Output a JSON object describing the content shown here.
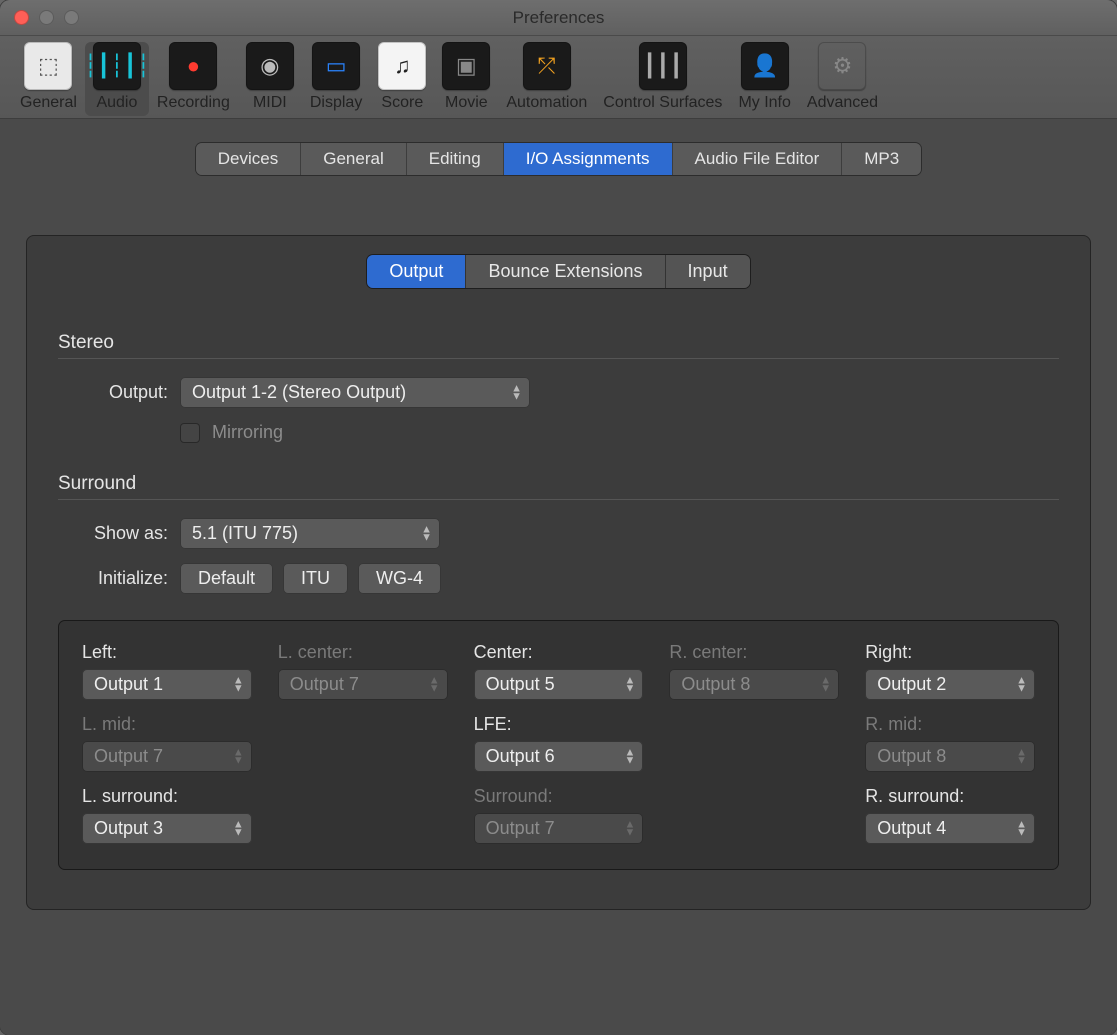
{
  "window": {
    "title": "Preferences"
  },
  "traffic": {
    "close": "#ff5f57",
    "min": "#7a7a7a",
    "max": "#7a7a7a"
  },
  "toolbar": [
    {
      "id": "general",
      "label": "General",
      "icon_bg": "#e9e9e9",
      "glyph": "⬚",
      "glyph_color": "#555"
    },
    {
      "id": "audio",
      "label": "Audio",
      "icon_bg": "#1a1a1a",
      "glyph": "┆┃┆┃┆",
      "glyph_color": "#18c4d8",
      "selected": true
    },
    {
      "id": "recording",
      "label": "Recording",
      "icon_bg": "#1a1a1a",
      "glyph": "●",
      "glyph_color": "#ff3b30"
    },
    {
      "id": "midi",
      "label": "MIDI",
      "icon_bg": "#1a1a1a",
      "glyph": "◉",
      "glyph_color": "#bbb"
    },
    {
      "id": "display",
      "label": "Display",
      "icon_bg": "#1a1a1a",
      "glyph": "▭",
      "glyph_color": "#2a84ff"
    },
    {
      "id": "score",
      "label": "Score",
      "icon_bg": "#f4f4f4",
      "glyph": "♫",
      "glyph_color": "#222"
    },
    {
      "id": "movie",
      "label": "Movie",
      "icon_bg": "#1a1a1a",
      "glyph": "▣",
      "glyph_color": "#888"
    },
    {
      "id": "automation",
      "label": "Automation",
      "icon_bg": "#1a1a1a",
      "glyph": "⤱",
      "glyph_color": "#f0a020"
    },
    {
      "id": "control",
      "label": "Control Surfaces",
      "icon_bg": "#1a1a1a",
      "glyph": "┃┃┃",
      "glyph_color": "#aaa"
    },
    {
      "id": "myinfo",
      "label": "My Info",
      "icon_bg": "#1a1a1a",
      "glyph": "👤",
      "glyph_color": "#777"
    },
    {
      "id": "advanced",
      "label": "Advanced",
      "icon_bg": "transparent",
      "glyph": "⚙︎",
      "glyph_color": "#888"
    }
  ],
  "tabs": {
    "items": [
      "Devices",
      "General",
      "Editing",
      "I/O Assignments",
      "Audio File Editor",
      "MP3"
    ],
    "active": "I/O Assignments"
  },
  "subtabs": {
    "items": [
      "Output",
      "Bounce Extensions",
      "Input"
    ],
    "active": "Output"
  },
  "stereo": {
    "title": "Stereo",
    "output_label": "Output:",
    "output_value": "Output 1-2 (Stereo Output)",
    "mirroring_label": "Mirroring"
  },
  "surround": {
    "title": "Surround",
    "showas_label": "Show as:",
    "showas_value": "5.1 (ITU 775)",
    "init_label": "Initialize:",
    "init_buttons": [
      "Default",
      "ITU",
      "WG-4"
    ],
    "channels": [
      {
        "label": "Left:",
        "value": "Output 1",
        "enabled": true,
        "col": 1,
        "row": 1
      },
      {
        "label": "L. center:",
        "value": "Output 7",
        "enabled": false,
        "col": 2,
        "row": 1
      },
      {
        "label": "Center:",
        "value": "Output 5",
        "enabled": true,
        "col": 3,
        "row": 1
      },
      {
        "label": "R. center:",
        "value": "Output 8",
        "enabled": false,
        "col": 4,
        "row": 1
      },
      {
        "label": "Right:",
        "value": "Output 2",
        "enabled": true,
        "col": 5,
        "row": 1
      },
      {
        "label": "L. mid:",
        "value": "Output 7",
        "enabled": false,
        "col": 1,
        "row": 2
      },
      {
        "label": "LFE:",
        "value": "Output 6",
        "enabled": true,
        "col": 3,
        "row": 2
      },
      {
        "label": "R. mid:",
        "value": "Output 8",
        "enabled": false,
        "col": 5,
        "row": 2
      },
      {
        "label": "L. surround:",
        "value": "Output 3",
        "enabled": true,
        "col": 1,
        "row": 3
      },
      {
        "label": "Surround:",
        "value": "Output 7",
        "enabled": false,
        "col": 3,
        "row": 3
      },
      {
        "label": "R. surround:",
        "value": "Output 4",
        "enabled": true,
        "col": 5,
        "row": 3
      }
    ]
  }
}
